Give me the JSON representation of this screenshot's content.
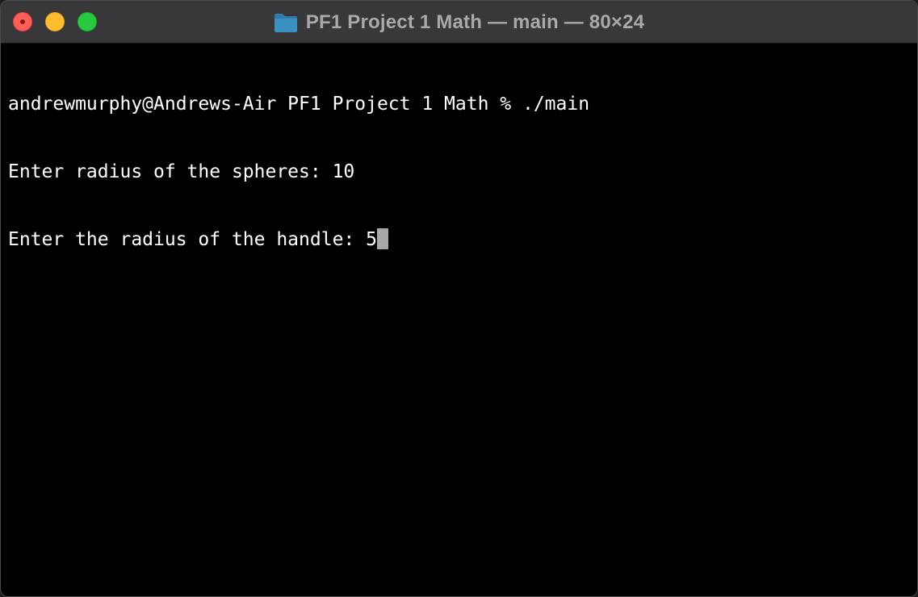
{
  "window": {
    "title": "PF1 Project 1 Math — main — 80×24",
    "folder_icon": "folder-icon",
    "accent_colors": {
      "close": "#fe5f57",
      "minimize": "#febc2e",
      "maximize": "#28c840"
    }
  },
  "terminal": {
    "lines": [
      "andrewmurphy@Andrews-Air PF1 Project 1 Math % ./main",
      "Enter radius of the spheres: 10",
      "Enter the radius of the handle: 5"
    ],
    "background": "#000000",
    "foreground": "#ffffff",
    "cursor_color": "#a8a8a8"
  }
}
